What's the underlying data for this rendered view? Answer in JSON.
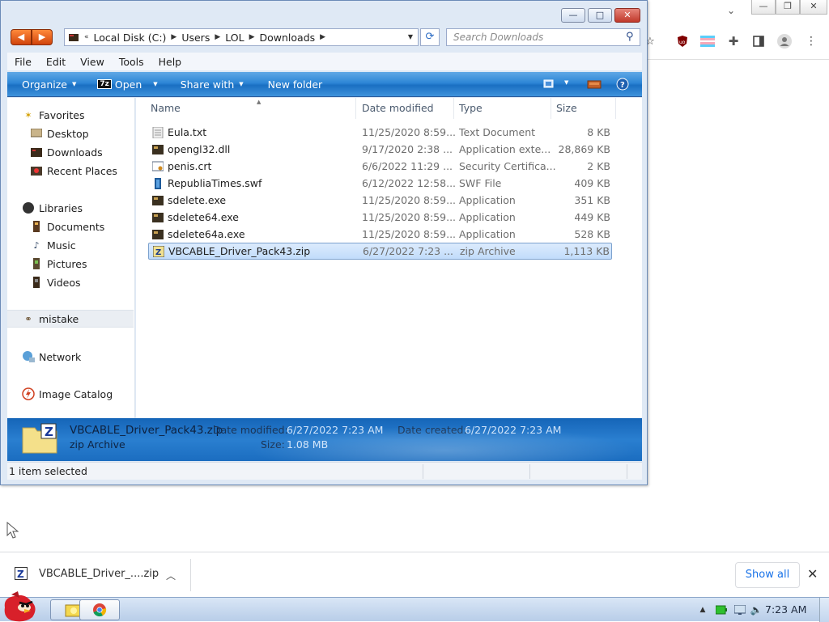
{
  "explorer": {
    "address": {
      "crumbs": [
        "Local Disk (C:)",
        "Users",
        "LOL",
        "Downloads"
      ],
      "leading": "«"
    },
    "search": {
      "placeholder": "Search Downloads"
    },
    "menu": [
      "File",
      "Edit",
      "View",
      "Tools",
      "Help"
    ],
    "commands": {
      "organize": "Organize",
      "open": "Open",
      "open_badge": "7z",
      "share": "Share with",
      "new_folder": "New folder"
    },
    "nav": {
      "favorites": "Favorites",
      "favorites_items": [
        "Desktop",
        "Downloads",
        "Recent Places"
      ],
      "libraries": "Libraries",
      "libraries_items": [
        "Documents",
        "Music",
        "Pictures",
        "Videos"
      ],
      "homegroup": "mistake",
      "network": "Network",
      "image_catalog": "Image Catalog"
    },
    "columns": {
      "name": "Name",
      "date": "Date modified",
      "type": "Type",
      "size": "Size"
    },
    "files": [
      {
        "name": "Eula.txt",
        "date": "11/25/2020 8:59...",
        "type": "Text Document",
        "size": "8 KB",
        "icon": "text-file-icon"
      },
      {
        "name": "opengl32.dll",
        "date": "9/17/2020 2:38 ...",
        "type": "Application exte...",
        "size": "28,869 KB",
        "icon": "application-icon"
      },
      {
        "name": "penis.crt",
        "date": "6/6/2022 11:29 ...",
        "type": "Security Certifica...",
        "size": "2 KB",
        "icon": "certificate-icon"
      },
      {
        "name": "RepubliaTimes.swf",
        "date": "6/12/2022 12:58...",
        "type": "SWF File",
        "size": "409 KB",
        "icon": "swf-file-icon"
      },
      {
        "name": "sdelete.exe",
        "date": "11/25/2020 8:59...",
        "type": "Application",
        "size": "351 KB",
        "icon": "application-icon"
      },
      {
        "name": "sdelete64.exe",
        "date": "11/25/2020 8:59...",
        "type": "Application",
        "size": "449 KB",
        "icon": "application-icon"
      },
      {
        "name": "sdelete64a.exe",
        "date": "11/25/2020 8:59...",
        "type": "Application",
        "size": "528 KB",
        "icon": "application-icon"
      },
      {
        "name": "VBCABLE_Driver_Pack43.zip",
        "date": "6/27/2022 7:23 ...",
        "type": "zip Archive",
        "size": "1,113 KB",
        "icon": "zip-archive-icon",
        "selected": true
      }
    ],
    "details": {
      "name": "VBCABLE_Driver_Pack43.zip",
      "type": "zip Archive",
      "modified_label": "Date modified:",
      "modified_value": "6/27/2022 7:23 AM",
      "created_label": "Date created:",
      "created_value": "6/27/2022 7:23 AM",
      "size_label": "Size:",
      "size_value": "1.08 MB"
    },
    "status": "1 item selected"
  },
  "download_bar": {
    "file": "VBCABLE_Driver_....zip",
    "show_all": "Show all"
  },
  "taskbar": {
    "clock": "7:23 AM"
  },
  "colors": {
    "command_bar": "#2d86d6",
    "selection": "#c1dcfb",
    "accent_link": "#1a73e8"
  }
}
